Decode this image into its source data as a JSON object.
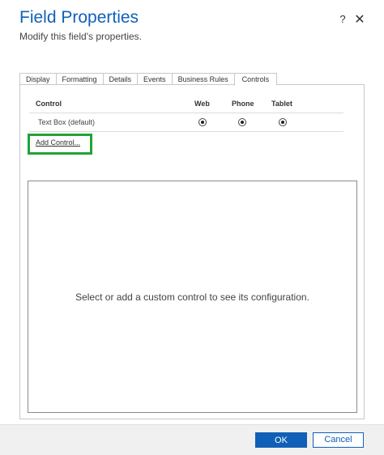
{
  "dialog": {
    "title": "Field Properties",
    "subtitle": "Modify this field's properties.",
    "help_label": "?",
    "close_label": "✕"
  },
  "tabs": [
    {
      "label": "Display",
      "active": false
    },
    {
      "label": "Formatting",
      "active": false
    },
    {
      "label": "Details",
      "active": false
    },
    {
      "label": "Events",
      "active": false
    },
    {
      "label": "Business Rules",
      "active": false
    },
    {
      "label": "Controls",
      "active": true
    }
  ],
  "controls_grid": {
    "headers": {
      "control": "Control",
      "web": "Web",
      "phone": "Phone",
      "tablet": "Tablet"
    },
    "rows": [
      {
        "control": "Text Box (default)",
        "web": true,
        "phone": true,
        "tablet": true
      }
    ]
  },
  "add_control": {
    "label": "Add Control...",
    "highlight_color": "#23a236"
  },
  "config_panel": {
    "message": "Select or add a custom control to see its configuration."
  },
  "footer": {
    "ok_label": "OK",
    "cancel_label": "Cancel"
  },
  "colors": {
    "accent": "#1160b7",
    "highlight": "#23a236"
  }
}
